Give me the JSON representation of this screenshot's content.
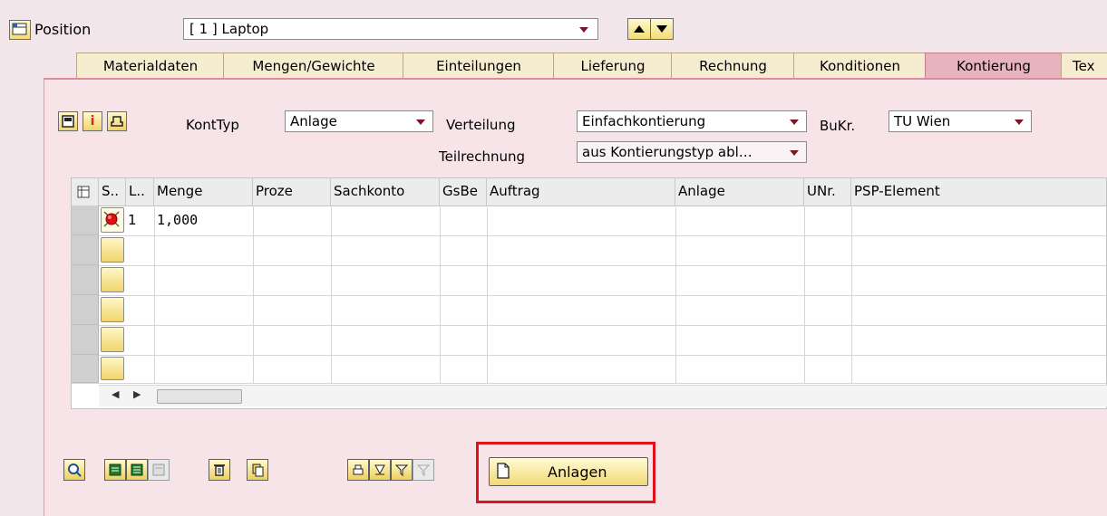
{
  "position": {
    "label": "Position",
    "value": "[ 1 ] Laptop"
  },
  "tabs": [
    {
      "label": "Materialdaten"
    },
    {
      "label": "Mengen/Gewichte"
    },
    {
      "label": "Einteilungen"
    },
    {
      "label": "Lieferung"
    },
    {
      "label": "Rechnung"
    },
    {
      "label": "Konditionen"
    },
    {
      "label": "Kontierung"
    },
    {
      "label": "Tex"
    }
  ],
  "kontierung": {
    "konttyp_label": "KontTyp",
    "konttyp_value": "Anlage",
    "verteilung_label": "Verteilung",
    "verteilung_value": "Einfachkontierung",
    "bukr_label": "BuKr.",
    "bukr_value": "TU Wien",
    "teilrechnung_label": "Teilrechnung",
    "teilrechnung_value": "aus Kontierungstyp abl…"
  },
  "grid": {
    "columns": [
      "S..",
      "L..",
      "Menge",
      "Proze",
      "Sachkonto",
      "GsBe",
      "Auftrag",
      "Anlage",
      "UNr.",
      "PSP-Element"
    ],
    "rows": [
      {
        "line": "1",
        "menge": "1,000",
        "status": "error"
      },
      {
        "line": "",
        "menge": "",
        "status": "empty"
      },
      {
        "line": "",
        "menge": "",
        "status": "empty"
      },
      {
        "line": "",
        "menge": "",
        "status": "empty"
      },
      {
        "line": "",
        "menge": "",
        "status": "empty"
      },
      {
        "line": "",
        "menge": "",
        "status": "empty"
      }
    ]
  },
  "footer": {
    "anlagen_button": "Anlagen"
  },
  "colors": {
    "background": "#f2e6ea",
    "active_tab": "#e7b3bf",
    "highlight_frame": "#e0141e",
    "button_yellow": "#f0d36a"
  }
}
